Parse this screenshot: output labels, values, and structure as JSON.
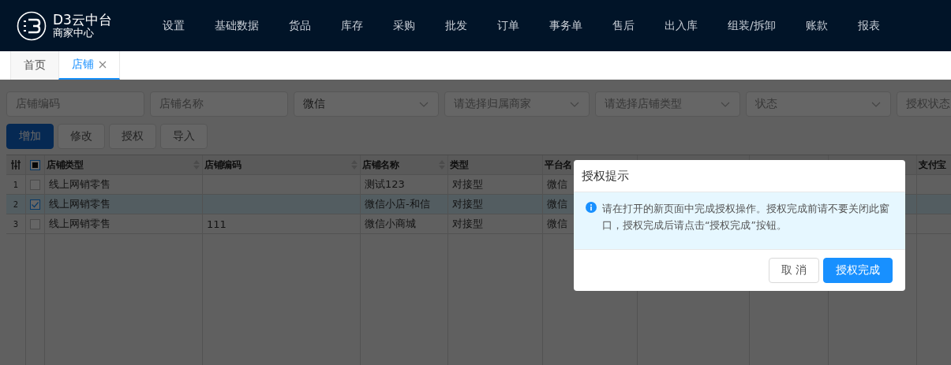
{
  "header": {
    "title": "D3云中台",
    "subtitle": "商家中心",
    "menu": [
      {
        "label": "设置"
      },
      {
        "label": "基础数据"
      },
      {
        "label": "货品"
      },
      {
        "label": "库存"
      },
      {
        "label": "采购"
      },
      {
        "label": "批发"
      },
      {
        "label": "订单"
      },
      {
        "label": "事务单"
      },
      {
        "label": "售后"
      },
      {
        "label": "出入库"
      },
      {
        "label": "组装/拆卸"
      },
      {
        "label": "账款"
      },
      {
        "label": "报表"
      }
    ]
  },
  "tabs": [
    {
      "label": "首页",
      "selected": false,
      "closable": false
    },
    {
      "label": "店铺",
      "selected": true,
      "closable": true
    }
  ],
  "filters": [
    {
      "kind": "input",
      "placeholder": "店铺编码"
    },
    {
      "kind": "input",
      "placeholder": "店铺名称"
    },
    {
      "kind": "select",
      "value": "微信"
    },
    {
      "kind": "select",
      "placeholder": "请选择归属商家"
    },
    {
      "kind": "select",
      "placeholder": "请选择店铺类型"
    },
    {
      "kind": "select",
      "placeholder": "状态"
    },
    {
      "kind": "select",
      "placeholder": "授权状态"
    }
  ],
  "toolbar": [
    {
      "label": "增加",
      "primary": true
    },
    {
      "label": "修改",
      "primary": false
    },
    {
      "label": "授权",
      "primary": false
    },
    {
      "label": "导入",
      "primary": false
    }
  ],
  "table": {
    "select_all_indeterminate": true,
    "columns": [
      {
        "kind": "sortable",
        "label": "店铺类型"
      },
      {
        "kind": "sortable",
        "label": "店铺编码"
      },
      {
        "kind": "sortable",
        "label": "店铺名称"
      },
      {
        "kind": "plain",
        "label": "类型"
      },
      {
        "kind": "plain",
        "label": "平台名"
      },
      {
        "kind": "covered"
      },
      {
        "kind": "covered"
      },
      {
        "kind": "covered"
      },
      {
        "kind": "plain",
        "label": "支付宝"
      }
    ],
    "rows": [
      {
        "index": "1",
        "checked": false,
        "selected": false,
        "store_type": "线上网销零售",
        "store_name": "测试123",
        "type": "对接型",
        "platform": "微信"
      },
      {
        "index": "2",
        "checked": true,
        "selected": true,
        "store_type": "线上网销零售",
        "store_name": "微信小店-和信",
        "type": "对接型",
        "platform": "微信"
      },
      {
        "index": "3",
        "checked": false,
        "selected": false,
        "store_type": "线上网销零售",
        "store_code": "111",
        "store_name": "微信小商城",
        "type": "对接型",
        "platform": "微信"
      }
    ]
  },
  "dialog": {
    "title": "授权提示",
    "message": "请在打开的新页面中完成授权操作。授权完成前请不要关闭此窗口，授权完成后请点击“授权完成”按钮。",
    "buttons": [
      {
        "label": "取 消",
        "primary": false
      },
      {
        "label": "授权完成",
        "primary": true
      }
    ]
  }
}
